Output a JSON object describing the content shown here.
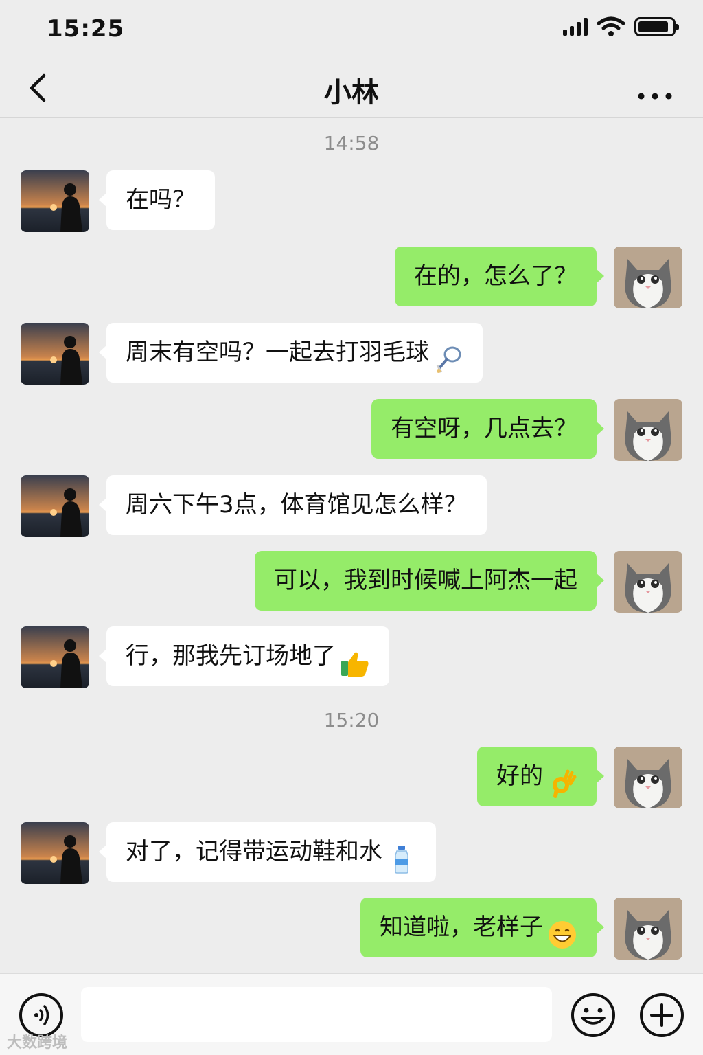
{
  "status_bar": {
    "time": "15:25",
    "battery_level": 0.9
  },
  "header": {
    "title": "小林"
  },
  "chat": {
    "timestamps": [
      "14:58",
      "15:20"
    ],
    "messages": [
      {
        "side": "left",
        "text": "在吗？"
      },
      {
        "side": "right",
        "text": "在的，怎么了？"
      },
      {
        "side": "left",
        "text": "周末有空吗？一起去打羽毛球",
        "emoji": "badminton-icon"
      },
      {
        "side": "right",
        "text": "有空呀，几点去？"
      },
      {
        "side": "left",
        "text": "周六下午3点，体育馆见怎么样？"
      },
      {
        "side": "right",
        "text": "可以，我到时候喊上阿杰一起"
      },
      {
        "side": "left",
        "text": "行，那我先订场地了",
        "emoji": "thumbs-up-icon"
      },
      {
        "side": "right",
        "text": "好的",
        "emoji": "ok-hand-icon"
      },
      {
        "side": "left",
        "text": "对了，记得带运动鞋和水",
        "emoji": "water-bottle-icon"
      },
      {
        "side": "right",
        "text": "知道啦，老样子",
        "emoji": "grinning-face-icon"
      }
    ]
  },
  "input": {
    "value": "",
    "placeholder": ""
  },
  "watermark": "大数跨境",
  "colors": {
    "background": "#ededed",
    "sent_bubble": "#95ec69",
    "received_bubble": "#ffffff"
  }
}
